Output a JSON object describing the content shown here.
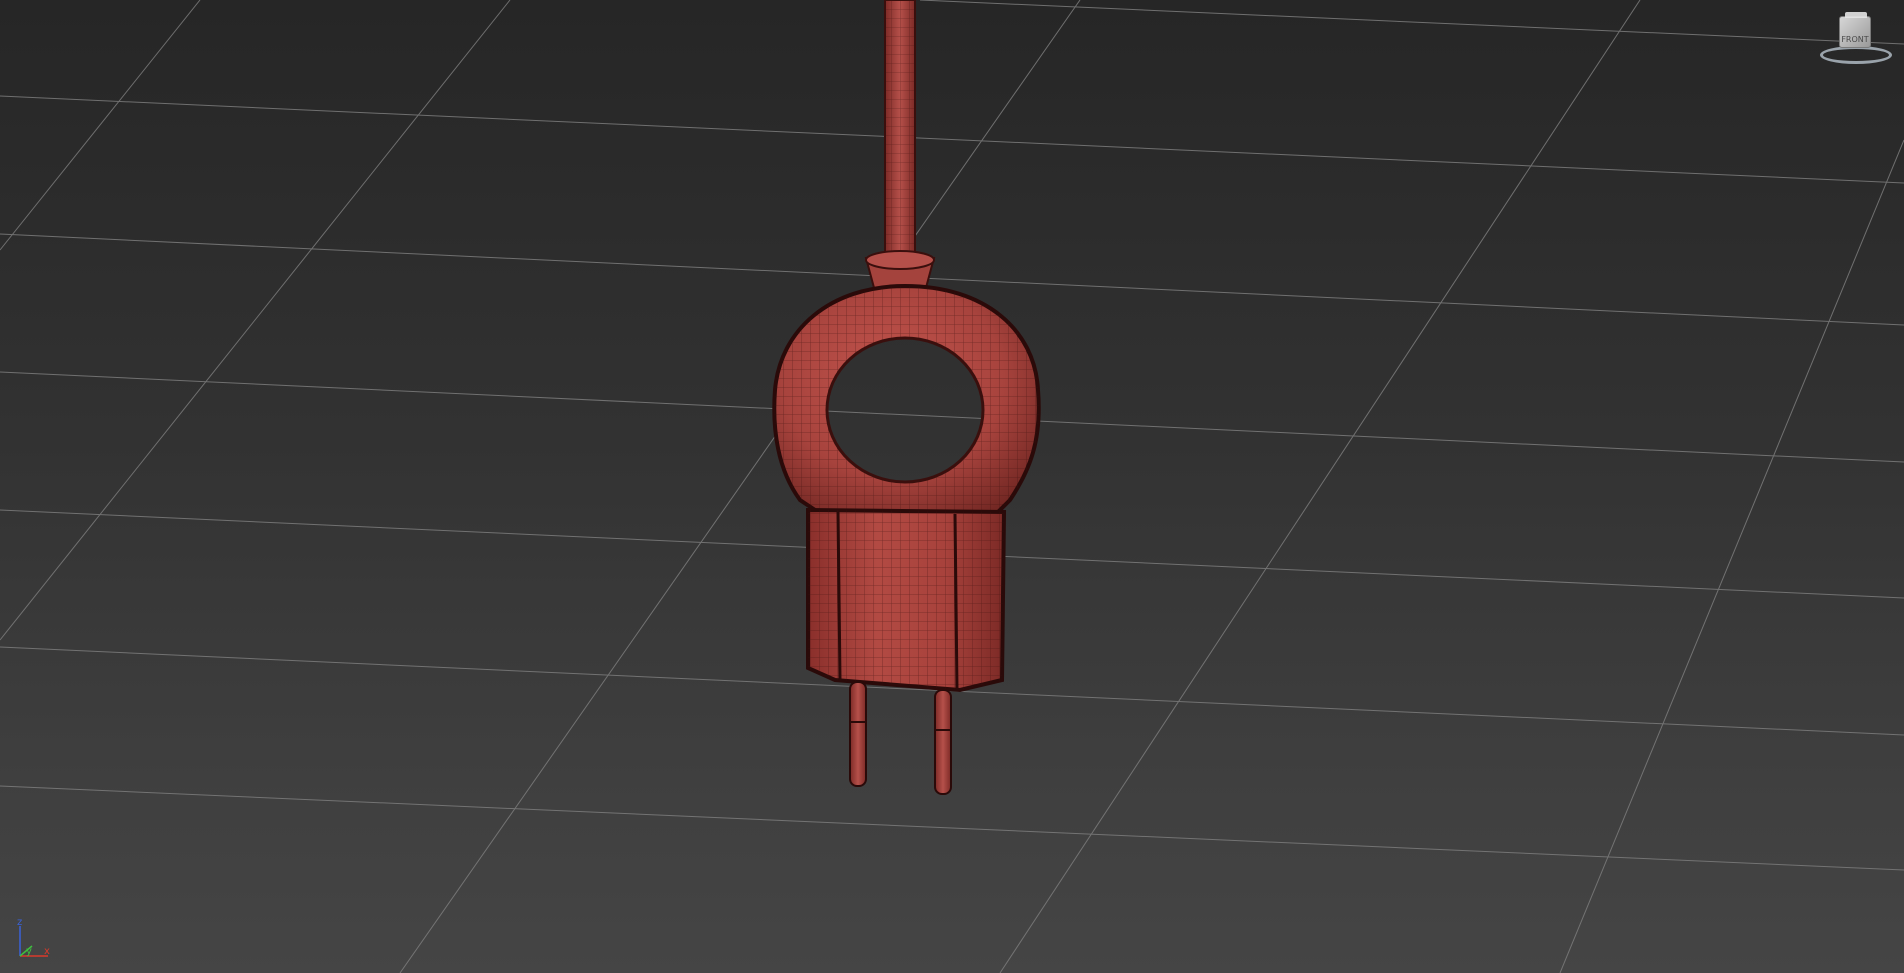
{
  "viewport": {
    "background_top": "#262626",
    "background_bottom": "#454545",
    "grid_color": "#7a7a7a",
    "model_color": "#9b3a35",
    "wire_color": "#3a0f0d"
  },
  "viewcube": {
    "face_label": "FRONT",
    "icon": "viewcube-icon"
  },
  "axis_tripod": {
    "x_label": "x",
    "y_label": "y",
    "z_label": "z",
    "x_color": "#d93a2b",
    "y_color": "#3fbf3f",
    "z_color": "#3a62d9"
  }
}
